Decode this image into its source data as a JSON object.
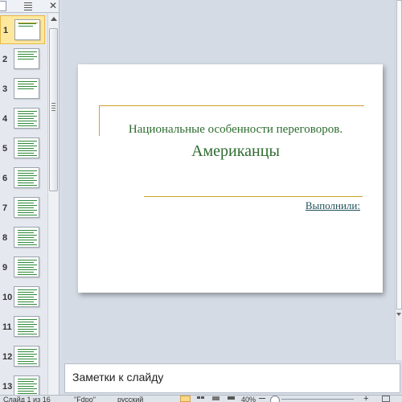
{
  "slides_panel": {
    "close_glyph": "✕",
    "slides": [
      {
        "number": "1",
        "selected": true
      },
      {
        "number": "2",
        "selected": false
      },
      {
        "number": "3",
        "selected": false
      },
      {
        "number": "4",
        "selected": false
      },
      {
        "number": "5",
        "selected": false
      },
      {
        "number": "6",
        "selected": false
      },
      {
        "number": "7",
        "selected": false
      },
      {
        "number": "8",
        "selected": false
      },
      {
        "number": "9",
        "selected": false
      },
      {
        "number": "10",
        "selected": false
      },
      {
        "number": "11",
        "selected": false
      },
      {
        "number": "12",
        "selected": false
      },
      {
        "number": "13",
        "selected": false
      }
    ]
  },
  "slide": {
    "title": "Национальные особенности переговоров.",
    "subtitle": "Американцы",
    "author_label": "Выполнили:"
  },
  "notes": {
    "placeholder": "Заметки к слайду"
  },
  "status_bar": {
    "slide_info": "Слайд 1 из 16",
    "theme": "\"Fdpo\"",
    "language": "русский",
    "zoom": "40%",
    "zoom_plus": "+"
  },
  "colors": {
    "title_green": "#2e6b2f",
    "accent_gold": "#c9a22c",
    "selection_yellow": "#fde89e"
  }
}
